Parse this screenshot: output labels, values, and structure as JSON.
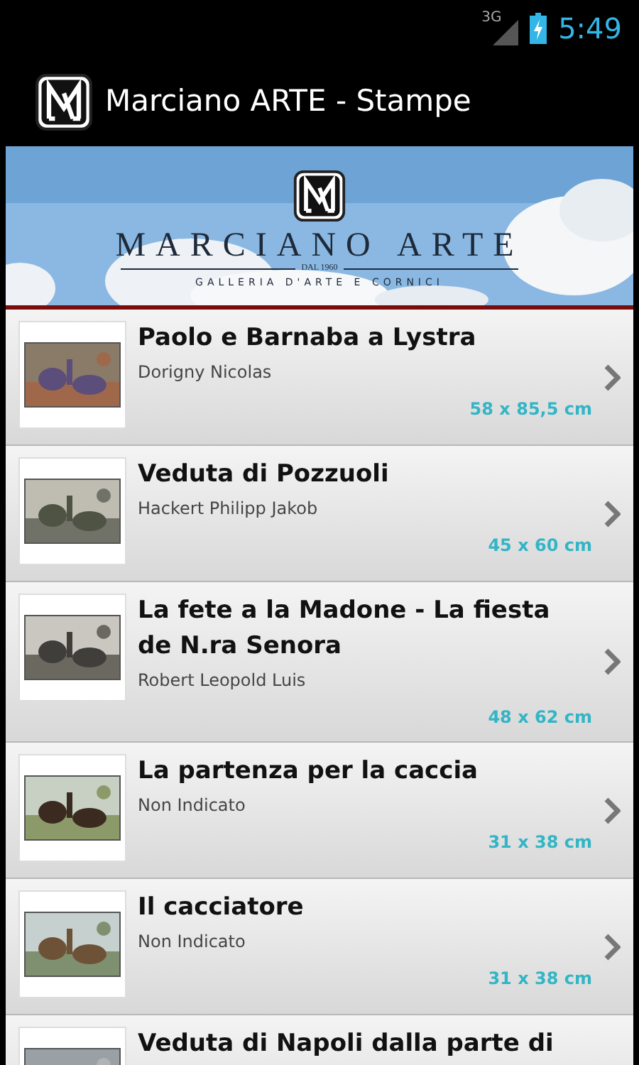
{
  "status_bar": {
    "network": "3G",
    "time": "5:49"
  },
  "action_bar": {
    "title": "Marciano ARTE - Stampe"
  },
  "banner": {
    "name": "MARCIANO ARTE",
    "since": "DAL 1960",
    "tagline": "GALLERIA D'ARTE E CORNICI"
  },
  "items": [
    {
      "title": "Paolo e Barnaba a Lystra",
      "artist": "Dorigny Nicolas",
      "size": "58 x 85,5 cm"
    },
    {
      "title": "Veduta di Pozzuoli",
      "artist": "Hackert Philipp Jakob",
      "size": "45 x 60 cm"
    },
    {
      "title": "La fete a la Madone - La fiesta de N.ra Senora",
      "artist": "Robert Leopold Luis",
      "size": "48 x 62 cm"
    },
    {
      "title": "La partenza per la caccia",
      "artist": "Non Indicato",
      "size": "31 x 38 cm"
    },
    {
      "title": "Il cacciatore",
      "artist": "Non Indicato",
      "size": "31 x 38 cm"
    },
    {
      "title": "Veduta di Napoli dalla parte di"
    }
  ]
}
